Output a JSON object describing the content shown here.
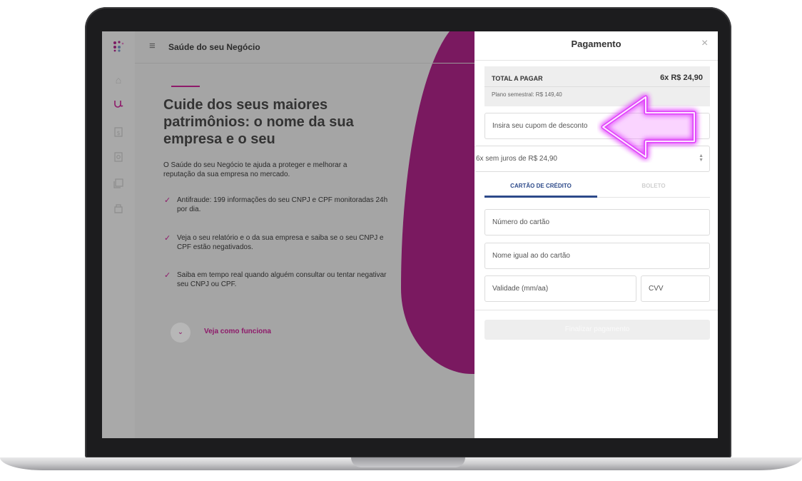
{
  "header": {
    "title": "Saúde do seu Negócio"
  },
  "sidebar": {
    "items": [
      {
        "icon": "home-icon"
      },
      {
        "icon": "stethoscope-icon"
      },
      {
        "icon": "document-dollar-icon"
      },
      {
        "icon": "search-document-icon"
      },
      {
        "icon": "stack-icon"
      },
      {
        "icon": "box-icon"
      }
    ],
    "active_color": "#8e1a6a"
  },
  "hero": {
    "headline": "Cuide dos seus maiores patrimônios: o nome da sua empresa e o seu",
    "lead": "O Saúde do seu Negócio te ajuda a proteger e melhorar a reputação da sua empresa no mercado.",
    "features": [
      "Antifraude: 199 informações do seu CNPJ e CPF monitoradas 24h por dia.",
      "Veja o seu relatório e o da sua empresa e saiba se o seu CNPJ e CPF estão negativados.",
      "Saiba em tempo real quando alguém consultar ou tentar negativar seu CNPJ ou CPF."
    ],
    "how_it_works": "Veja como funciona"
  },
  "payment": {
    "title": "Pagamento",
    "total_label": "TOTAL A PAGAR",
    "total_value": "6x R$ 24,90",
    "plan_text": "Plano semestral: R$ 149,40",
    "coupon_placeholder": "Insira seu cupom de desconto",
    "installments_selected": "6x sem juros de R$ 24,90",
    "tabs": [
      {
        "label": "CARTÃO DE CRÉDITO",
        "active": true
      },
      {
        "label": "BOLETO",
        "active": false
      }
    ],
    "card_number_placeholder": "Número do cartão",
    "card_name_placeholder": "Nome igual ao do cartão",
    "expiry_placeholder": "Validade (mm/aa)",
    "cvv_placeholder": "CVV",
    "submit_label": "Finalizar pagamento"
  },
  "colors": {
    "brand": "#8e1a6a",
    "tab_active": "#2d4a8a",
    "arrow_glow": "#e040fb"
  }
}
